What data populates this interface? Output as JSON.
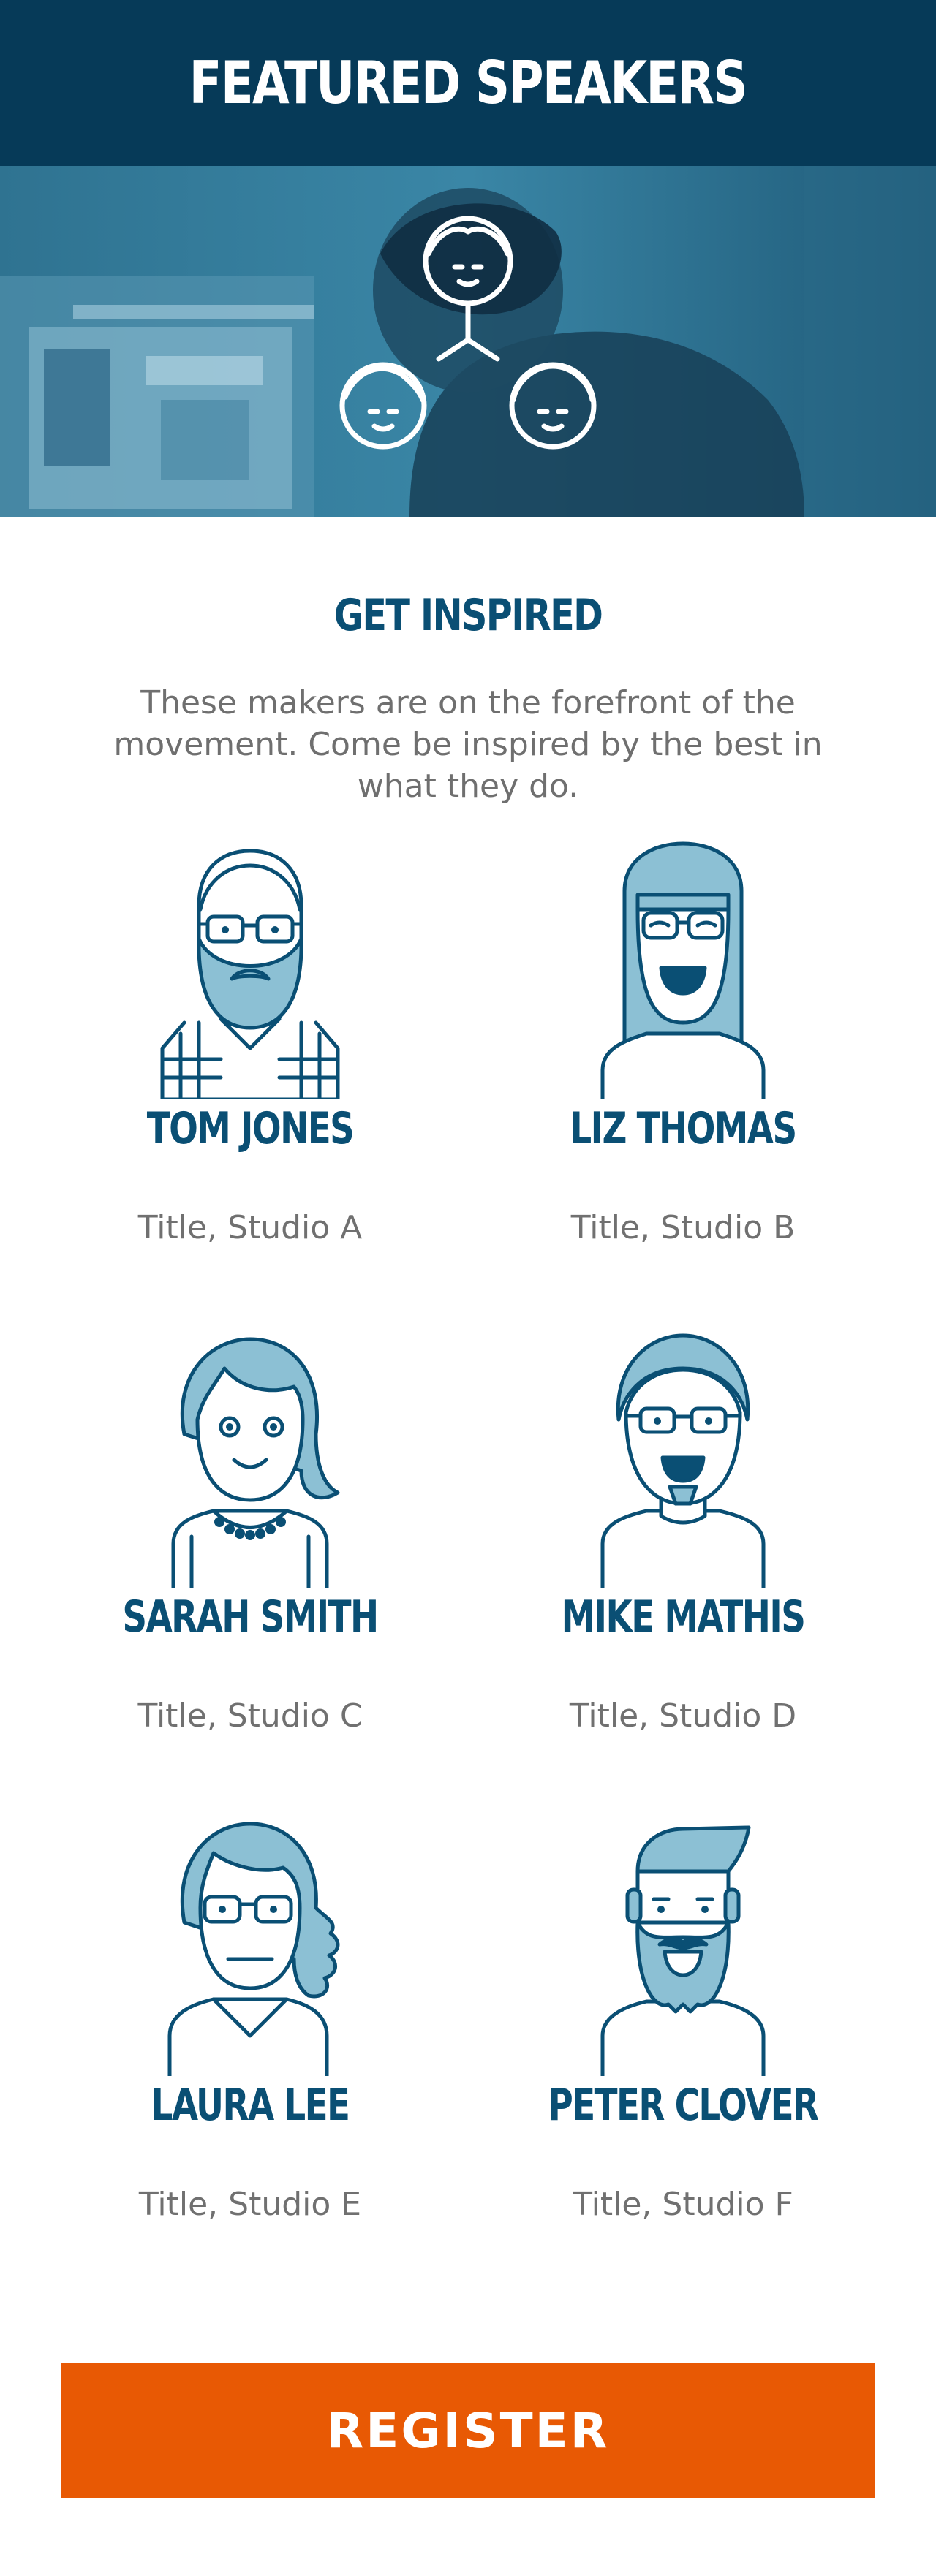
{
  "header": {
    "title": "FEATURED SPEAKERS"
  },
  "hero": {
    "icon": "team-network-icon"
  },
  "intro": {
    "heading": "GET INSPIRED",
    "text": "These makers are on the forefront of the movement. Come be inspired by the best in what they do."
  },
  "speakers": [
    {
      "name": "TOM JONES",
      "title": "Title, Studio A",
      "avatar": "bearded-man-glasses-avatar"
    },
    {
      "name": "LIZ THOMAS",
      "title": "Title, Studio B",
      "avatar": "long-hair-woman-glasses-avatar"
    },
    {
      "name": "SARAH SMITH",
      "title": "Title, Studio C",
      "avatar": "bob-hair-woman-necklace-avatar"
    },
    {
      "name": "MIKE MATHIS",
      "title": "Title, Studio D",
      "avatar": "man-glasses-goatee-avatar"
    },
    {
      "name": "LAURA LEE",
      "title": "Title, Studio E",
      "avatar": "wavy-hair-woman-glasses-avatar"
    },
    {
      "name": "PETER CLOVER",
      "title": "Title, Studio F",
      "avatar": "bearded-man-quiff-avatar"
    }
  ],
  "cta": {
    "label": "REGISTER"
  },
  "colors": {
    "header_bg": "#063a58",
    "accent": "#0a4f74",
    "light_fill": "#8cc0d4",
    "cta": "#e85904",
    "body_text": "#6f6f6f"
  }
}
